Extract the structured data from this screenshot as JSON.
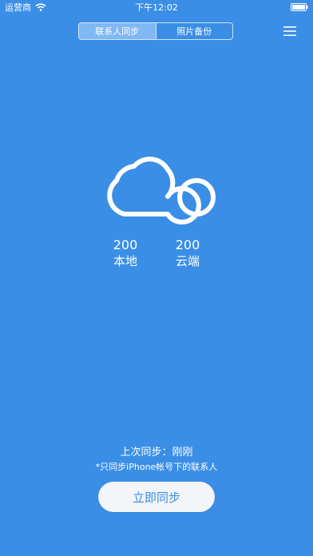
{
  "status_bar": {
    "carrier": "运营商",
    "time": "下午12:02"
  },
  "tabs": [
    {
      "label": "联系人同步",
      "active": true
    },
    {
      "label": "照片备份",
      "active": false
    }
  ],
  "counts": {
    "local": {
      "value": "200",
      "label": "本地"
    },
    "cloud": {
      "value": "200",
      "label": "云端"
    }
  },
  "last_sync": "上次同步：刚刚",
  "note": "*只同步iPhone帐号下的联系人",
  "sync_button": "立即同步",
  "colors": {
    "background": "#3a8ee6",
    "button_bg": "#f3f5f9",
    "button_text": "#3a8ee6"
  },
  "icons": {
    "wifi": "wifi-icon",
    "battery": "battery-icon",
    "menu": "hamburger-menu-icon",
    "cloud": "cloud-logo-icon"
  }
}
